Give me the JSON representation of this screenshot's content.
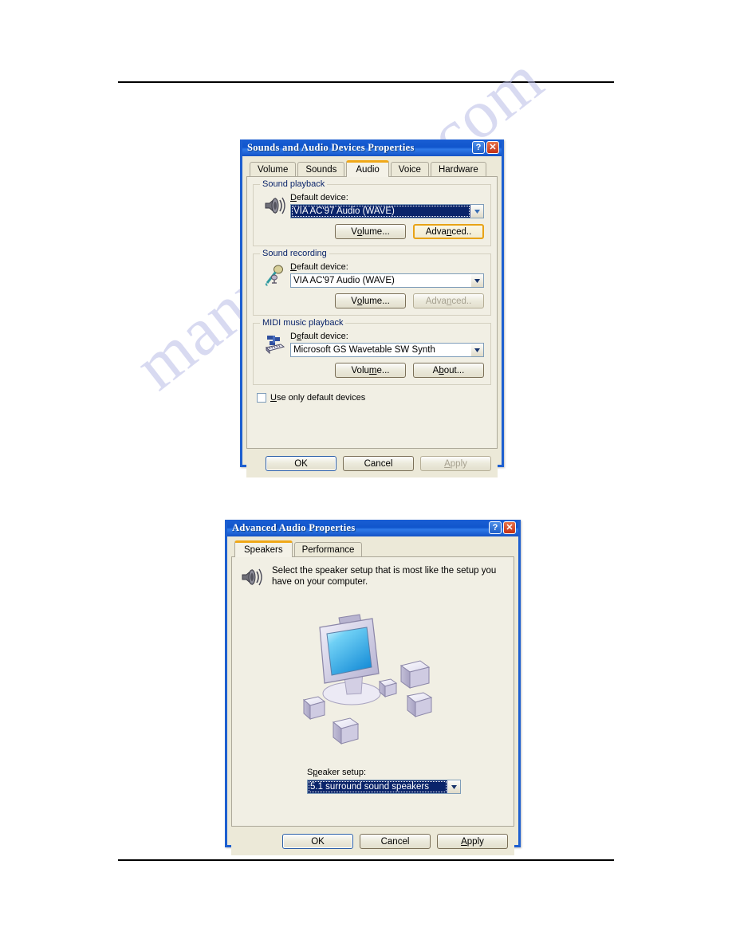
{
  "document": {
    "watermark": "manualshive.com",
    "rules": [
      "page-top-rule",
      "page-bottom-rule"
    ]
  },
  "dialog_sounds": {
    "title": "Sounds and Audio Devices Properties",
    "titlebar_buttons": [
      {
        "name": "help-button",
        "glyph": "?"
      },
      {
        "name": "close-button",
        "glyph": "✕"
      }
    ],
    "tabs": [
      {
        "label": "Volume",
        "active": false
      },
      {
        "label": "Sounds",
        "active": false
      },
      {
        "label": "Audio",
        "active": true
      },
      {
        "label": "Voice",
        "active": false
      },
      {
        "label": "Hardware",
        "active": false
      }
    ],
    "groups": [
      {
        "label": "Sound playback",
        "icon": "speaker-icon",
        "field_label_prefix": "D",
        "field_label_rest": "efault device:",
        "combo_value": "VIA AC'97 Audio (WAVE)",
        "combo_selected": true,
        "buttons": [
          {
            "label_pre": "V",
            "label_key": "o",
            "label_post": "lume...",
            "state": "enabled"
          },
          {
            "label_pre": "Adva",
            "label_key": "n",
            "label_post": "ced..",
            "state": "focus"
          }
        ]
      },
      {
        "label": "Sound recording",
        "icon": "microphone-icon",
        "field_label_prefix": "D",
        "field_label_rest": "efault device:",
        "combo_value": "VIA AC'97 Audio (WAVE)",
        "combo_selected": false,
        "buttons": [
          {
            "label_pre": "V",
            "label_key": "o",
            "label_post": "lume...",
            "state": "enabled"
          },
          {
            "label_pre": "Adva",
            "label_key": "n",
            "label_post": "ced..",
            "state": "disabled"
          }
        ]
      },
      {
        "label": "MIDI music playback",
        "icon": "midi-keyboard-icon",
        "field_label_prefix": "D",
        "field_label_rest": "efault device:",
        "combo_value": "Microsoft GS Wavetable SW Synth",
        "combo_selected": false,
        "buttons": [
          {
            "label_pre": "Volu",
            "label_key": "m",
            "label_post": "e...",
            "state": "enabled"
          },
          {
            "label_pre": "A",
            "label_key": "b",
            "label_post": "out...",
            "state": "enabled"
          }
        ]
      }
    ],
    "checkbox": {
      "label_pre": "",
      "label_key": "U",
      "label_post": "se only default devices",
      "checked": false
    },
    "footer_buttons": [
      {
        "label": "OK",
        "state": "default"
      },
      {
        "label": "Cancel",
        "state": "enabled"
      },
      {
        "label_pre": "",
        "label_key": "A",
        "label_post": "pply",
        "state": "disabled"
      }
    ]
  },
  "dialog_advanced": {
    "title": "Advanced Audio Properties",
    "titlebar_buttons": [
      {
        "name": "help-button",
        "glyph": "?"
      },
      {
        "name": "close-button",
        "glyph": "✕"
      }
    ],
    "tabs": [
      {
        "label": "Speakers",
        "active": true
      },
      {
        "label": "Performance",
        "active": false
      }
    ],
    "intro": {
      "icon": "speaker-icon",
      "text": "Select the speaker setup that is most like the setup you have on your computer."
    },
    "illustration": {
      "name": "monitor-with-surround-speakers-illustration",
      "speaker_count": 5,
      "monitor_screen_color": "#3fb8f0"
    },
    "speaker_setup": {
      "label_pre": "S",
      "label_key": "p",
      "label_post": "eaker setup:",
      "value": "5.1 surround sound speakers",
      "selected": true
    },
    "footer_buttons": [
      {
        "label": "OK",
        "state": "default"
      },
      {
        "label": "Cancel",
        "state": "enabled"
      },
      {
        "label_pre": "",
        "label_key": "A",
        "label_post": "pply",
        "state": "enabled"
      }
    ]
  },
  "colors": {
    "titlebar_blue": "#1055cc",
    "dialog_face": "#ece9d8",
    "panel_face": "#f1efe4",
    "group_label_blue": "#0a246a",
    "active_tab_accent": "#f0a818",
    "selection_blue": "#0a246a",
    "watermark": "#b9bce6"
  }
}
